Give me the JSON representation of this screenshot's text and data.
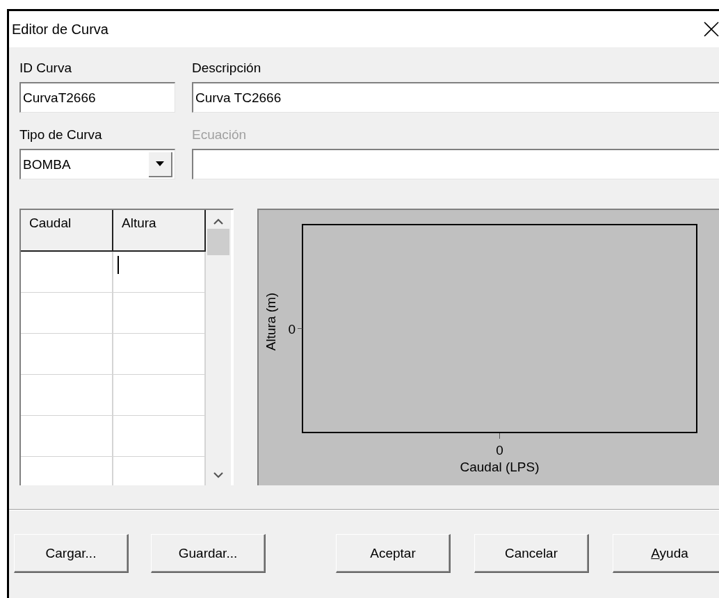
{
  "window": {
    "title": "Editor de Curva"
  },
  "id_field": {
    "label": "ID Curva",
    "value": "CurvaT2666"
  },
  "description_field": {
    "label": "Descripción",
    "value": "Curva TC2666"
  },
  "curve_type": {
    "label": "Tipo de Curva",
    "value": "BOMBA"
  },
  "equation_field": {
    "label": "Ecuación",
    "disabled": true
  },
  "table": {
    "columns": [
      "Caudal",
      "Altura"
    ],
    "rows": [
      {
        "editing": true
      },
      {
        "editing": false
      },
      {
        "editing": false
      },
      {
        "editing": false
      },
      {
        "editing": false
      },
      {
        "editing": false
      }
    ]
  },
  "chart": {
    "x_axis_title": "Caudal (LPS)",
    "y_axis_title": "Altura (m)",
    "x_tick": "0",
    "y_tick": "0"
  },
  "buttons_left": [
    {
      "label": "Cargar...",
      "mnemonic": false
    },
    {
      "label": "Guardar...",
      "mnemonic": false
    }
  ],
  "buttons_right": [
    {
      "label": "Aceptar",
      "mnemonic": false
    },
    {
      "label": "Cancelar",
      "mnemonic": false
    },
    {
      "label": "Ayuda",
      "mnemonic": true
    }
  ]
}
